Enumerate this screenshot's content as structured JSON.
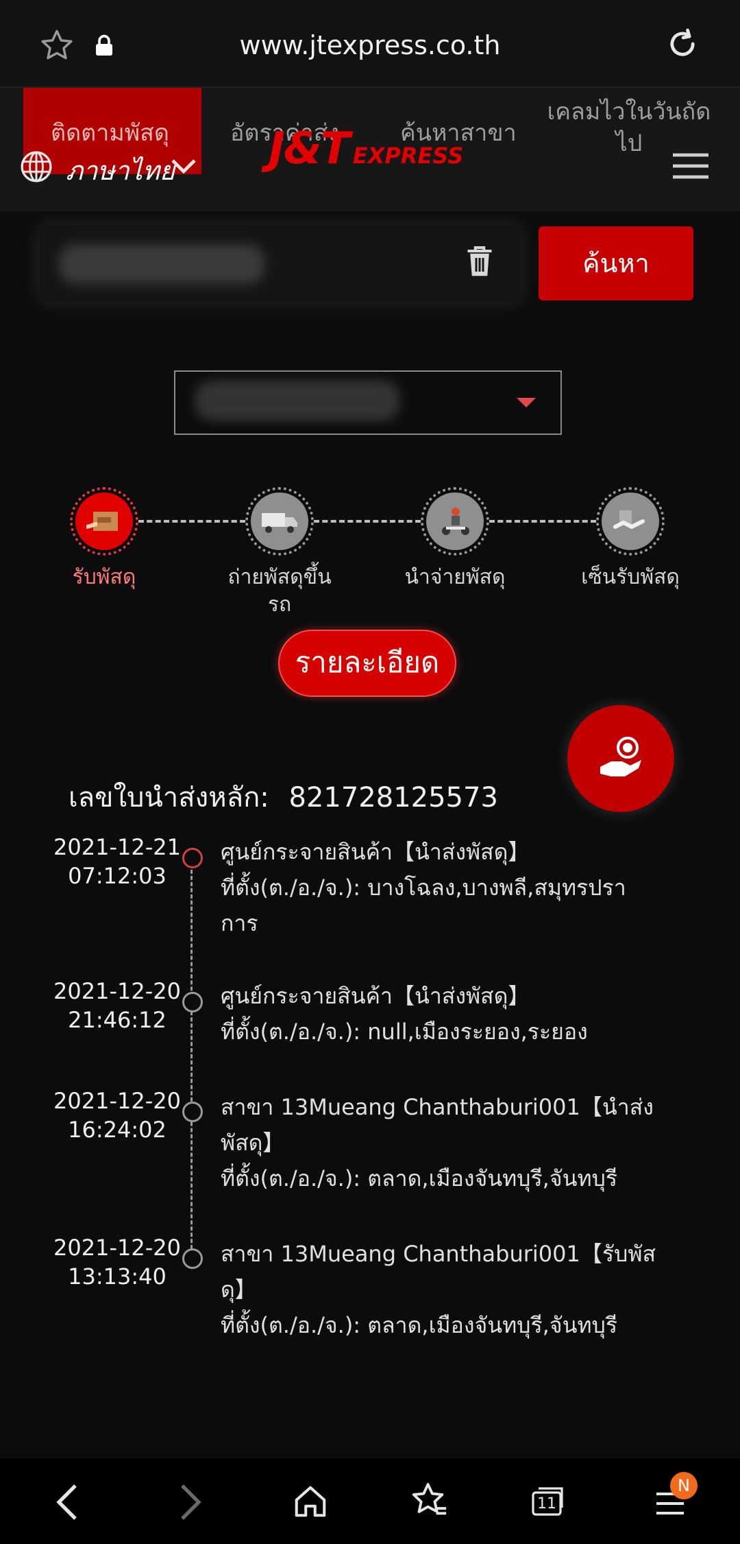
{
  "browser": {
    "url": "www.jtexpress.co.th",
    "tabs_count": "11",
    "menu_badge": "N"
  },
  "nav": {
    "tracking": "ติดตามพัสดุ",
    "rates": "อัตราค่าส่ง",
    "branches": "ค้นหาสาขา",
    "claim_line1": "เคลมไวในวันถัด",
    "claim_line2": "ไป",
    "language": "ภาษาไทย"
  },
  "logo": {
    "main": "J&T",
    "sub": "EXPRESS"
  },
  "search": {
    "button_label": "ค้นหา"
  },
  "steps": [
    {
      "label": "รับพัสดุ",
      "active": true
    },
    {
      "label": "ถ่ายพัสดุขึ้น",
      "label2": "รถ",
      "active": false
    },
    {
      "label": "นำจ่ายพัสดุ",
      "active": false
    },
    {
      "label": "เซ็นรับพัสดุ",
      "active": false
    }
  ],
  "details_button": "รายละเอียด",
  "waybill": {
    "label": "เลขใบนำส่งหลัก:",
    "number": "821728125573"
  },
  "timeline": [
    {
      "date": "2021-12-21",
      "time": "07:12:03",
      "line1": "ศูนย์กระจายสินค้า【นำส่งพัสดุ】",
      "line2": "ที่ตั้ง(ต./อ./จ.): บางโฉลง,บางพลี,สมุทรปรา",
      "line3": "การ"
    },
    {
      "date": "2021-12-20",
      "time": "21:46:12",
      "line1": "ศูนย์กระจายสินค้า【นำส่งพัสดุ】",
      "line2": "ที่ตั้ง(ต./อ./จ.): null,เมืองระยอง,ระยอง",
      "line3": ""
    },
    {
      "date": "2021-12-20",
      "time": "16:24:02",
      "line1": "สาขา 13Mueang Chanthaburi001【นำส่ง",
      "line2": "พัสดุ】",
      "line3": "ที่ตั้ง(ต./อ./จ.): ตลาด,เมืองจันทบุรี,จันทบุรี"
    },
    {
      "date": "2021-12-20",
      "time": "13:13:40",
      "line1": "สาขา 13Mueang Chanthaburi001【รับพัส",
      "line2": "ดุ】",
      "line3": "ที่ตั้ง(ต./อ./จ.): ตลาด,เมืองจันทบุรี,จันทบุรี"
    }
  ],
  "colors": {
    "brand_red": "#c60000",
    "background": "#0c0c0c"
  }
}
